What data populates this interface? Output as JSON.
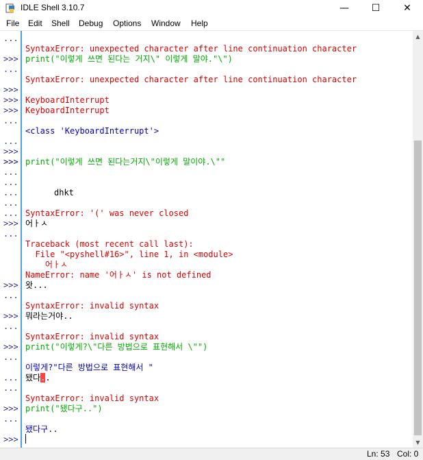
{
  "window": {
    "title": "IDLE Shell 3.10.7",
    "minimize": "—",
    "maximize": "☐",
    "close": "✕"
  },
  "menu": {
    "file": "File",
    "edit": "Edit",
    "shell": "Shell",
    "debug": "Debug",
    "options": "Options",
    "window": "Window",
    "help": "Help"
  },
  "prompts": {
    "p01": "...",
    "p02": ">>>",
    "p03": "...",
    "p04": ">>>",
    "p05": ">>>",
    "p06": ">>>",
    "p07": "...",
    "p08": "...",
    "p09": ">>>",
    "p10": ">>>",
    "p11": ">>>",
    "p12": "...",
    "p13": "...",
    "p14": "...",
    "p15": "...",
    "p16": "...",
    "p17": ">>>",
    "p18": "...",
    "p19": ">>>",
    "p20": "...",
    "p21": ">>>",
    "p22": "...",
    "p23": ">>>",
    "p24": "...",
    "p25": "...",
    "p26": "...",
    "p27": ">>>",
    "p28": "...",
    "p29": ">>>"
  },
  "shell": {
    "l01": "SyntaxError: unexpected character after line continuation character",
    "l02": "print(\"이렇게 쓰면 된다는 거지\\\" 이렇게 말야.\"\\\")",
    "l03": "SyntaxError: unexpected character after line continuation character",
    "l04": "KeyboardInterrupt",
    "l05": "KeyboardInterrupt",
    "l06": "<class 'KeyboardInterrupt'>",
    "l07": "print(\"이렇게 쓰면 된다는거지\\\"이렇게 말이야.\\\"\"",
    "l08": "dhkt",
    "l09": "SyntaxError: '(' was never closed",
    "l10": "어ㅏㅅ",
    "l11": "Traceback (most recent call last):",
    "l12": "  File \"<pyshell#16>\", line 1, in <module>",
    "l13": "    어ㅏㅅ",
    "l14": "NameError: name '어ㅏㅅ' is not defined",
    "l15": "왓...",
    "l16": "SyntaxError: invalid syntax",
    "l17": "뭐라는거야..",
    "l18": "SyntaxError: invalid syntax",
    "l19": "print(\"이렇게?\\\"다른 방법으로 표현해서 \\\"\")",
    "l20": "이렇게?\"다른 방법으로 표현해서 \"",
    "l21a": "됐다",
    "l21b": ".",
    "l21c": ".",
    "l22": "SyntaxError: invalid syntax",
    "l23": "print(\"됐다구..\")",
    "l24": "됐다구.."
  },
  "status": {
    "line": "Ln: 53",
    "col": "Col: 0"
  },
  "colors": {
    "error": "#dd0000",
    "string": "#00aa00",
    "output": "#0000c0",
    "prompt": "#2d2d87",
    "gutter_border": "#4d9fd8"
  }
}
